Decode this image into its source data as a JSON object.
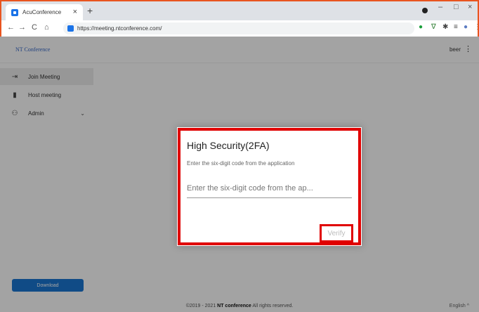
{
  "browser": {
    "tab_title": "AcuConference",
    "tab_close": "×",
    "new_tab": "+",
    "url": "https://meeting.ntconference.com/",
    "window_minimize": "–",
    "window_maximize": "□",
    "window_close": "×"
  },
  "app": {
    "brand": "NT Conference",
    "user": "beer",
    "menu_icon": "⋮"
  },
  "sidebar": {
    "items": [
      {
        "label": "Join Meeting",
        "icon": "login-icon",
        "active": true
      },
      {
        "label": "Host meeting",
        "icon": "host-icon",
        "active": false
      },
      {
        "label": "Admin",
        "icon": "admin-icon",
        "active": false,
        "chevron": "⌄"
      }
    ],
    "download_label": "Download"
  },
  "footer": {
    "copyright_prefix": "©2019 - 2021 ",
    "brand": "NT conference",
    "copyright_suffix": " All rights reserved.",
    "language": "English ^"
  },
  "dialog": {
    "title": "High Security(2FA)",
    "subtitle": "Enter the six-digit code from the application",
    "input_placeholder": "Enter the six-digit code from the ap...",
    "input_value": "",
    "verify_label": "Verify"
  },
  "colors": {
    "accent": "#1976d2",
    "highlight": "#e00000",
    "frame": "#e8541f"
  }
}
